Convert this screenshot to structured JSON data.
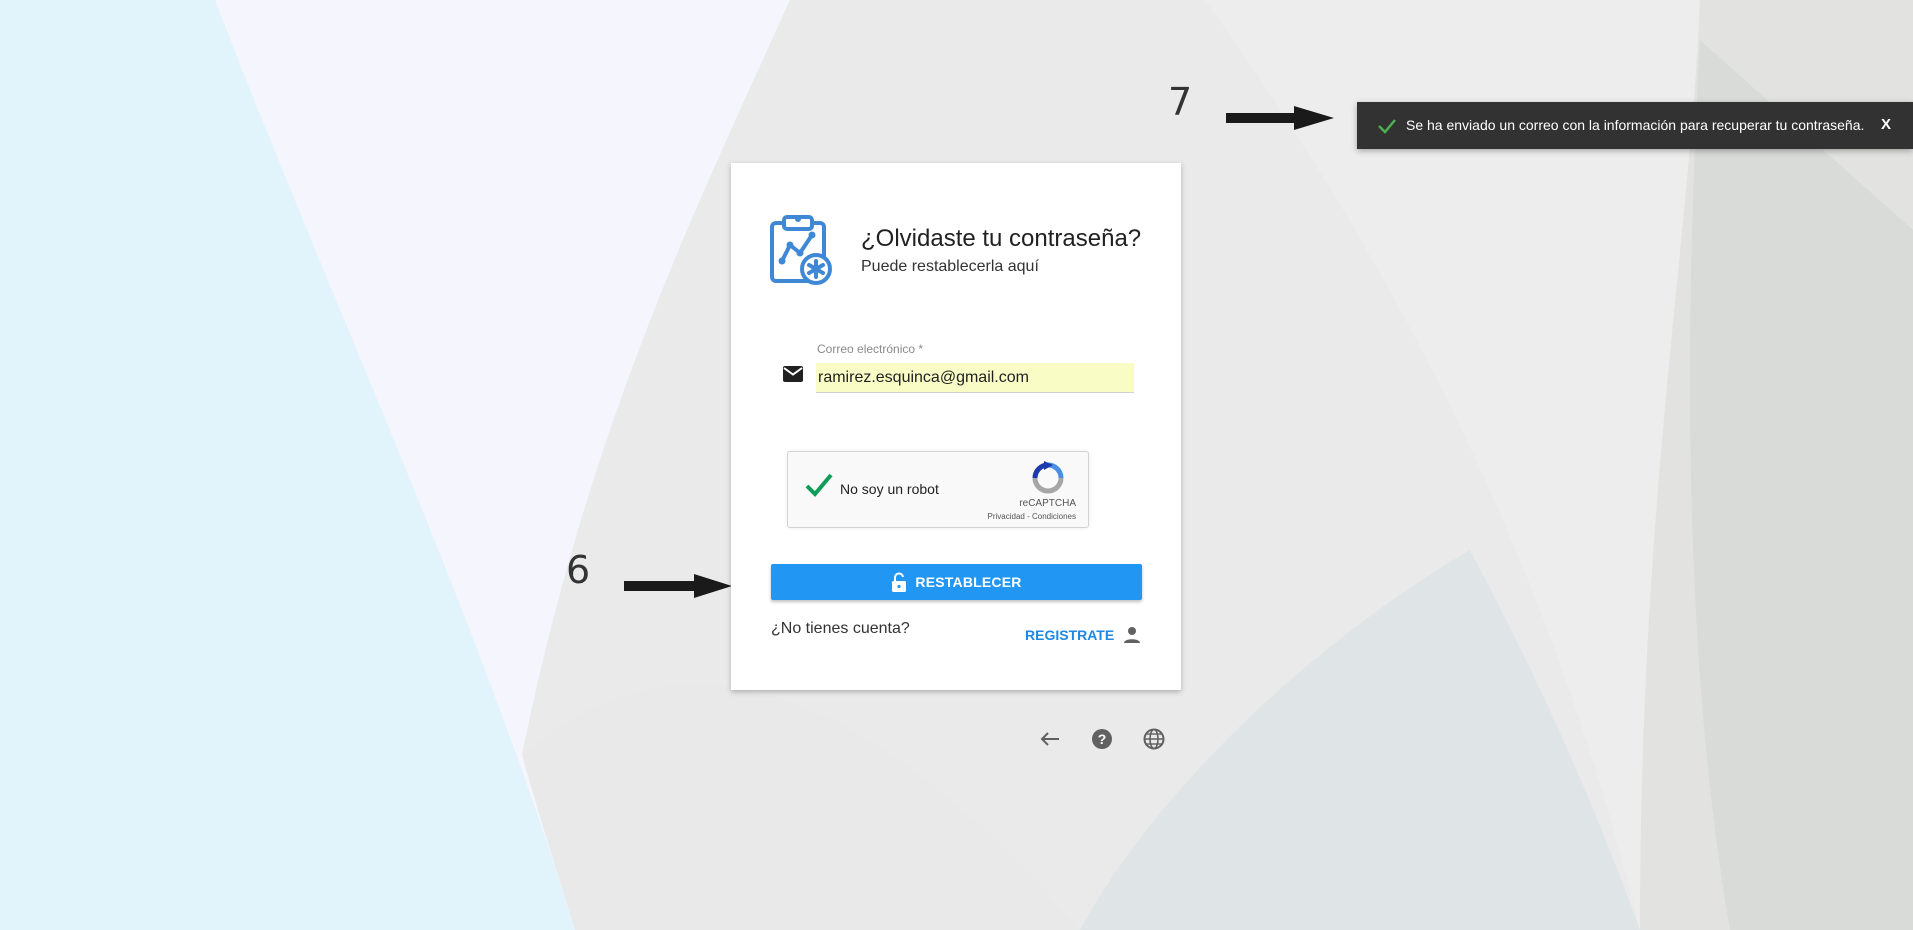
{
  "page": {
    "title": "¿Olvidaste tu contraseña?",
    "subtitle": "Puede restablecerla aquí"
  },
  "form": {
    "email_label": "Correo electrónico *",
    "email_value": "ramirez.esquinca@gmail.com"
  },
  "captcha": {
    "label": "No soy un robot",
    "brand": "reCAPTCHA",
    "links": "Privacidad - Condiciones",
    "checked": true
  },
  "actions": {
    "reset_label": "RESTABLECER",
    "no_account_text": "¿No tienes cuenta?",
    "register_label": "REGISTRATE"
  },
  "footer_icons": [
    "arrow-back-icon",
    "help-icon",
    "language-icon"
  ],
  "toast": {
    "message": "Se ha enviado un correo con la información para recuperar tu contraseña.",
    "close_label": "X"
  },
  "annotations": {
    "step_6": "6",
    "step_7": "7"
  },
  "colors": {
    "primary": "#2196f3",
    "link": "#1e88e5",
    "logo": "#3f88d6",
    "toast_bg": "#323232",
    "success": "#4caf50",
    "autofill": "#fafcc6"
  }
}
